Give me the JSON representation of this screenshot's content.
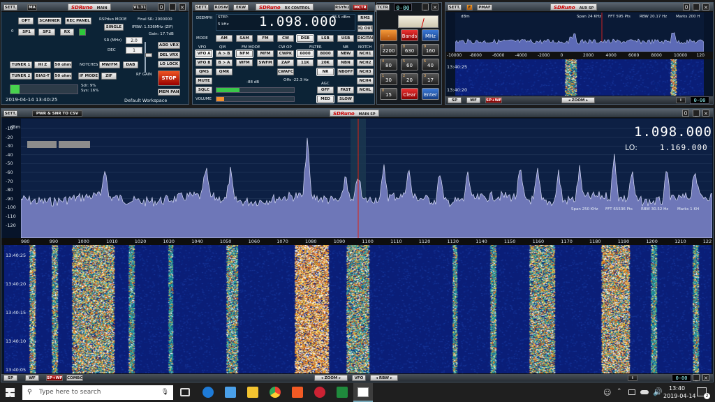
{
  "main_panel": {
    "sett": "SETT.",
    "ma": "MA",
    "logo": "SDRuno",
    "title": "MAIN",
    "version": "V1.31",
    "digit": "0",
    "opt": "OPT",
    "scanner": "SCANNER",
    "rec_panel": "REC PANEL",
    "rsp_mode": "RSPduo MODE",
    "single": "SINGLE",
    "final_sr": "Final SR: 2000000",
    "ifbw": "IFBW: 1.536MHz (ZIF)",
    "gain": "Gain: 17.7dB",
    "zero": "0",
    "sp1": "SP1",
    "sp2": "SP2",
    "rx": "RX",
    "sr_label": "SR (MHz)",
    "sr_value": "2.0",
    "dec_label": "DEC",
    "dec_value": "1",
    "add_vrx": "ADD VRX",
    "del_vrx": "DEL VRX",
    "lo_lock": "LO LOCK",
    "tuner1": "TUNER 1",
    "hi_z": "HI Z",
    "ohm50a": "50 ohm",
    "notches": "NOTCHES",
    "mwfm": "MW/FM",
    "dab": "DAB",
    "tuner2": "TUNER 2",
    "biast": "BIAS-T",
    "ohm50b": "50 ohm",
    "if_mode": "IF MODE",
    "zif": "ZIF",
    "rf_gain": "RF GAIN",
    "stop": "STOP",
    "sdr_load": "Sdr: 9%",
    "sys_load": "Sys: 16%",
    "mem_pan": "MEM PAN",
    "datetime": "2019-04-14 13:40:25",
    "workspace": "Default Workspace"
  },
  "rx_panel": {
    "sett": "SETT.",
    "rdsw": "RDSW",
    "ekw": "EKW",
    "logo": "SDRuno",
    "title": "RX CONTROL",
    "rsyn": "RSYN1",
    "mctr": "MCTR",
    "tctr": "TCTR",
    "deemph": "DEEMPH",
    "step_label": "STEP:",
    "step_value": "5 kHz",
    "frequency": "1.098.000",
    "level": "-48.5 dBm",
    "rms": "RMS",
    "iq_out": "IQ OUT",
    "mode_label": "MODE",
    "modes": [
      "AM",
      "SAM",
      "FM",
      "CW",
      "DSB",
      "LSB",
      "USB",
      "DIGITAL"
    ],
    "vfo_label": "VFO",
    "qm_label": "QM",
    "fm_mode_label": "FM MODE",
    "cw_op_label": "CW OP",
    "filter_label": "FILTER",
    "nb_label": "NB",
    "notch_label": "NOTCH",
    "vfo_a": "VFO A",
    "a_to_b": "A > B",
    "nfm": "NFM",
    "mfm": "MFM",
    "cwpk": "CWPK",
    "f6000": "6000",
    "f8000": "8000",
    "nbw": "NBW",
    "nch1": "NCH1",
    "vfo_b": "VFO B",
    "b_to_a": "B > A",
    "wfm": "WFM",
    "swfm": "SWFM",
    "zap": "ZAP",
    "f11k": "11K",
    "f20k": "20K",
    "nbn": "NBN",
    "nch2": "NCH2",
    "qms": "QMS",
    "qmr": "QMR",
    "cwafc": "CWAFC",
    "nr": "NR",
    "nboff": "NBOFF",
    "nch3": "NCH3",
    "mute": "MUTE",
    "squelch_level": "-88 dB",
    "offs": "Offs -22.3 Hz",
    "agc_label": "AGC",
    "nch4": "NCH4",
    "sqlc": "SQLC",
    "off": "OFF",
    "fast": "FAST",
    "nchl": "NCHL",
    "volume": "VOLUME",
    "med": "MED",
    "slow": "SLOW",
    "squelch_fill": 0.3,
    "volume_fill": 0.1
  },
  "keypad": {
    "seg": "0-00",
    "keys": [
      {
        "num": "",
        "label": "-"
      },
      {
        "num": "",
        "label": "Bands"
      },
      {
        "num": "",
        "label": "MHz"
      },
      {
        "num": "7",
        "label": "2200"
      },
      {
        "num": "8",
        "label": "630"
      },
      {
        "num": "9",
        "label": "160"
      },
      {
        "num": "4",
        "label": "80"
      },
      {
        "num": "5",
        "label": "60"
      },
      {
        "num": "6",
        "label": "40"
      },
      {
        "num": "1",
        "label": "30"
      },
      {
        "num": "2",
        "label": "20"
      },
      {
        "num": "3",
        "label": "17"
      },
      {
        "num": "0",
        "label": "15"
      },
      {
        "num": "",
        "label": "Clear"
      },
      {
        "num": "",
        "label": "Enter"
      }
    ]
  },
  "aux_panel": {
    "sett": "SETT.",
    "f": "F",
    "pmaf": "PMAF",
    "logo": "SDRuno",
    "title": "AUX SP",
    "digit": "0",
    "dbm": "dBm",
    "span": "Span 24 KHz",
    "fft": "FFT 595 Pts",
    "rbw": "RBW 20.17 Hz",
    "marks": "Marks 200 H",
    "x_ticks": [
      "-10000",
      "-8000",
      "-6000",
      "-4000",
      "-2000",
      "0",
      "2000",
      "4000",
      "6000",
      "8000",
      "10000",
      "120"
    ],
    "times": [
      "13:40:25",
      "13:40:20"
    ],
    "sp": "SP",
    "wf": "WF",
    "spwf": "SP+WF",
    "zoom": "ZOOM",
    "info": "i",
    "seg": "0-00"
  },
  "main_sp": {
    "sett": "SETT.",
    "pwr": "PWR & SNR TO CSV",
    "logo": "SDRuno",
    "title": "MAIN SP",
    "digit": "0",
    "dbm": "dBm",
    "y_ticks": [
      "-10",
      "-20",
      "-30",
      "-40",
      "-50",
      "-60",
      "-70",
      "-80",
      "-90",
      "-100",
      "-110",
      "-120"
    ],
    "frequency": "1.098.000",
    "lo_label": "LO:",
    "lo_value": "1.169.000",
    "span": "Span 250 KHz",
    "fft": "FFT 65536 Pts",
    "rbw": "RBW 30.52 Hz",
    "marks": "Marks 1 KH",
    "x_ticks": [
      "980",
      "990",
      "1000",
      "1010",
      "1020",
      "1030",
      "1040",
      "1050",
      "1060",
      "1070",
      "1080",
      "1090",
      "1100",
      "1110",
      "1120",
      "1130",
      "1140",
      "1150",
      "1160",
      "1170",
      "1180",
      "1190",
      "1200",
      "1210",
      "122"
    ],
    "wf_times": [
      "13:40:25",
      "13:40:20",
      "13:40:15",
      "13:40:10",
      "13:40:05"
    ],
    "sp": "SP",
    "wf": "WF",
    "spwf": "SP+WF",
    "combo": "COMBO",
    "zoom": "ZOOM",
    "vfo": "VFO",
    "rbw_btn": "RBW",
    "info": "i",
    "seg": "0-00"
  },
  "taskbar": {
    "search_placeholder": "Type here to search",
    "time": "13:40",
    "date": "2019-04-14",
    "notif": "2"
  }
}
